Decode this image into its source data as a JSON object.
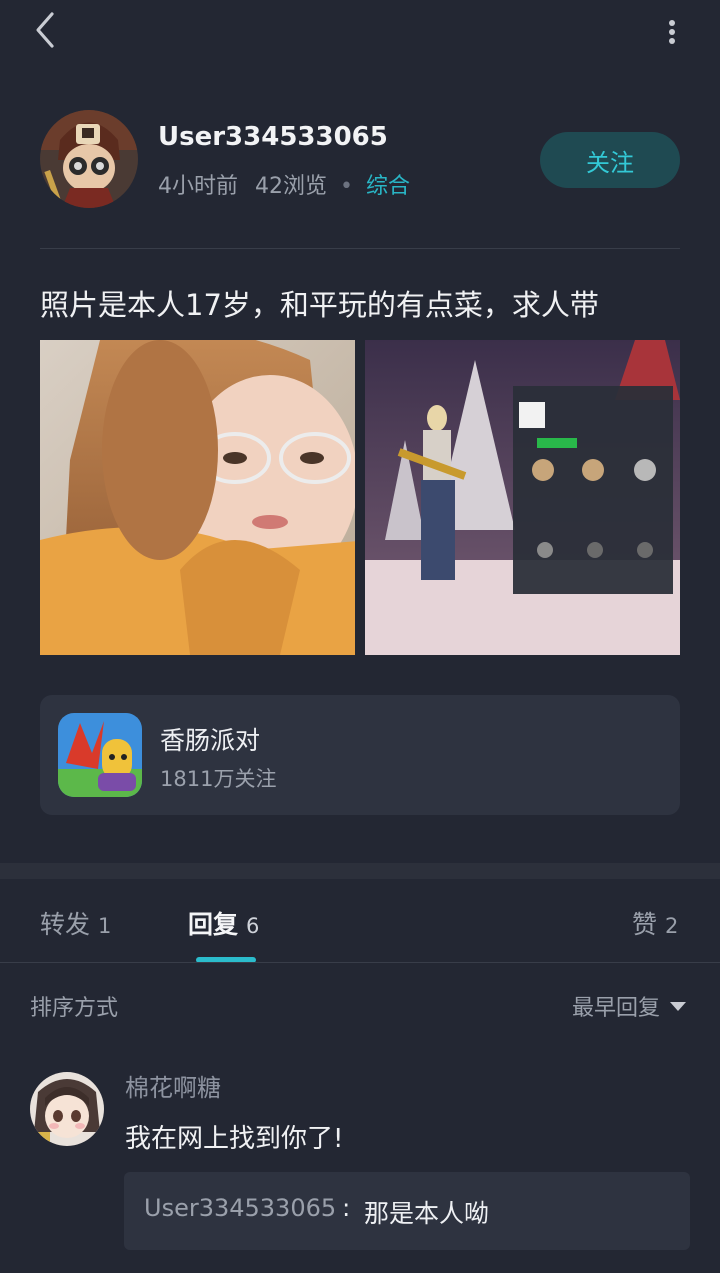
{
  "header": {
    "back_icon": "chevron-left-icon",
    "more_icon": "more-vertical-icon"
  },
  "author": {
    "name": "User334533065",
    "time": "4小时前",
    "views": "42浏览",
    "category": "综合",
    "follow_label": "关注"
  },
  "post": {
    "text": "照片是本人17岁，和平玩的有点菜，求人带"
  },
  "game_card": {
    "name": "香肠派对",
    "followers": "1811万关注"
  },
  "tabs": [
    {
      "label": "转发",
      "count": "1"
    },
    {
      "label": "回复",
      "count": "6"
    },
    {
      "label": "赞",
      "count": "2"
    }
  ],
  "sort": {
    "label": "排序方式",
    "selected": "最早回复"
  },
  "comment": {
    "user": "棉花啊糖",
    "text": "我在网上找到你了!",
    "reply_user": "User334533065",
    "reply_sep": ":",
    "reply_text": "那是本人呦"
  },
  "colors": {
    "accent": "#2bbccc",
    "background": "#232733",
    "card": "#2e3340"
  }
}
